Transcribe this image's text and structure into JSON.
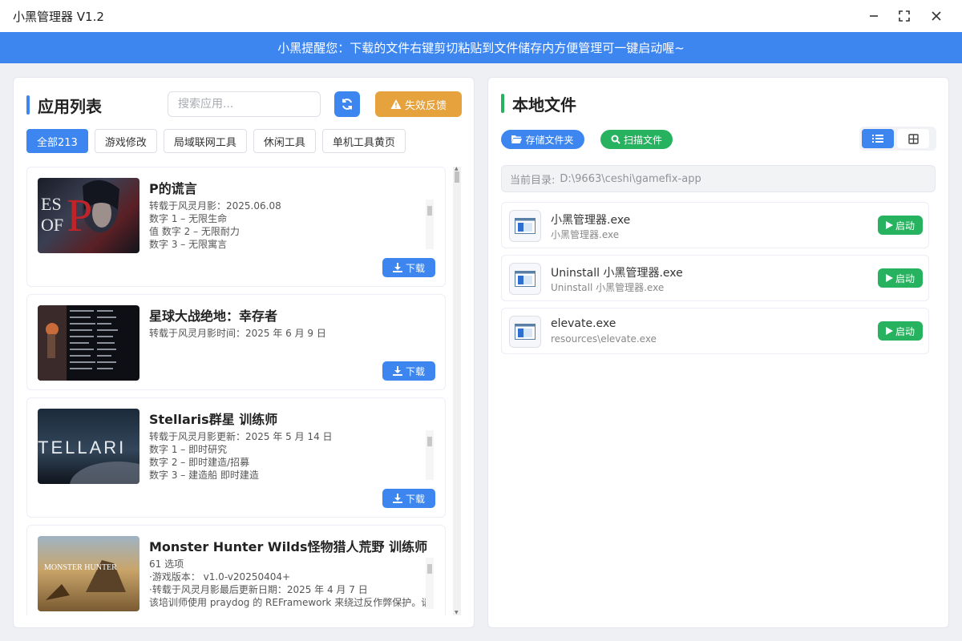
{
  "window": {
    "title": "小黑管理器 V1.2"
  },
  "banner": {
    "text": "小黑提醒您：下载的文件右键剪切粘贴到文件储存内方便管理可一键启动喔~"
  },
  "left": {
    "title": "应用列表",
    "search_placeholder": "搜索应用...",
    "feedback_label": "失效反馈",
    "tabs": [
      {
        "label": "全部213",
        "active": true
      },
      {
        "label": "游戏修改",
        "active": false
      },
      {
        "label": "局域联网工具",
        "active": false
      },
      {
        "label": "休闲工具",
        "active": false
      },
      {
        "label": "单机工具黄页",
        "active": false
      }
    ],
    "download_label": "下载",
    "apps": [
      {
        "name": "P的谎言",
        "thumb_text": "ES P\nOF",
        "desc": [
          "转载于风灵月影：2025.06.08",
          "数字 1 – 无限生命",
          "值 数字 2 – 无限耐力",
          "数字 3 – 无限寓言"
        ]
      },
      {
        "name": "星球大战绝地：幸存者",
        "thumb_text": "",
        "desc": [
          "转载于风灵月影时间：2025 年 6 月 9 日"
        ]
      },
      {
        "name": "Stellaris群星 训练师",
        "thumb_text": "TELLARI",
        "desc": [
          "转载于风灵月影更新：2025 年 5 月 14 日",
          "数字 1 – 即时研究",
          "数字 2 – 即时建造/招募",
          "数字 3 – 建造船 即时建造"
        ]
      },
      {
        "name": "Monster Hunter Wilds怪物猎人荒野 训练师",
        "thumb_text": "MONSTER HUNTER",
        "desc": [
          "61 选项",
          "·游戏版本： v1.0-v20250404+",
          "·转载于风灵月影最后更新日期：2025 年 4 月 7 日",
          "该培训师使用 praydog 的 REFramework 来绕过反作弊保护。请"
        ]
      }
    ]
  },
  "right": {
    "title": "本地文件",
    "folder_btn": "存储文件夹",
    "scan_btn": "扫描文件",
    "path_label": "当前目录:",
    "path_value": "D:\\9663\\ceshi\\gamefix-app",
    "launch_label": "启动",
    "files": [
      {
        "name": "小黑管理器.exe",
        "sub": "小黑管理器.exe"
      },
      {
        "name": "Uninstall 小黑管理器.exe",
        "sub": "Uninstall 小黑管理器.exe"
      },
      {
        "name": "elevate.exe",
        "sub": "resources\\elevate.exe"
      }
    ]
  }
}
